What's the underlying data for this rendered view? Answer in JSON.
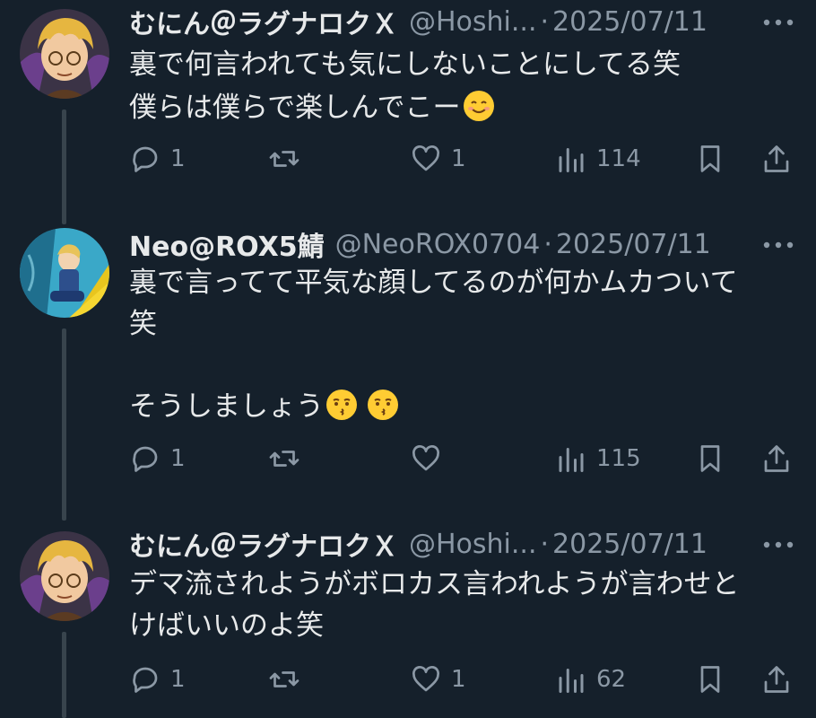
{
  "tweets": [
    {
      "name": "むにん＠ラグナロクＸ",
      "handle": "@Hoshi...",
      "separator": "·",
      "date": "2025/07/11",
      "text": "裏で何言われても気にしないことにしてる笑\n僕らは僕らで楽しんでこー",
      "emoji": [
        "smiling-face-icon"
      ],
      "replies": "1",
      "retweets": "",
      "likes": "1",
      "views": "114"
    },
    {
      "name": "Neo@ROX5鯖",
      "handle": "@NeoROX0704",
      "separator": "·",
      "date": "2025/07/11",
      "text": "裏で言ってて平気な顔してるのが何かムカついて\n笑\n\nそうしましょう",
      "emoji": [
        "kissing-face-icon",
        "kissing-face-icon"
      ],
      "replies": "1",
      "retweets": "",
      "likes": "",
      "views": "115"
    },
    {
      "name": "むにん＠ラグナロクＸ",
      "handle": "@Hoshi...",
      "separator": "·",
      "date": "2025/07/11",
      "text": "デマ流されようがボロカス言われようが言わせと\nけばいいのよ笑",
      "emoji": [],
      "replies": "1",
      "retweets": "",
      "likes": "1",
      "views": "62"
    }
  ],
  "colors": {
    "background": "#15202b",
    "text": "#e7e9ea",
    "muted": "#8b98a5",
    "thread_line": "#38444d"
  }
}
